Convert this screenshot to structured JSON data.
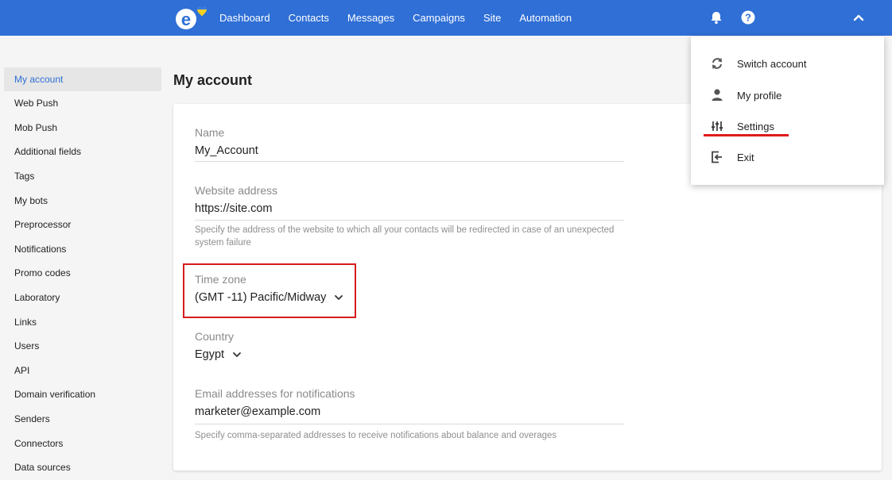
{
  "topbar": {
    "nav": [
      "Dashboard",
      "Contacts",
      "Messages",
      "Campaigns",
      "Site",
      "Automation"
    ],
    "colors": {
      "bar": "#2f6fd6",
      "logo_heart_top": "#3a7be0",
      "logo_heart_bottom": "#f5d020"
    },
    "icons": [
      "bell-icon",
      "help-icon",
      "chevron-up-icon"
    ]
  },
  "sidebar": {
    "items": [
      "My account",
      "Web Push",
      "Mob Push",
      "Additional fields",
      "Tags",
      "My bots",
      "Preprocessor",
      "Notifications",
      "Promo codes",
      "Laboratory",
      "Links",
      "Users",
      "API",
      "Domain verification",
      "Senders",
      "Connectors",
      "Data sources"
    ],
    "active": "My account"
  },
  "main": {
    "title": "My account",
    "name": {
      "label": "Name",
      "value": "My_Account"
    },
    "website": {
      "label": "Website address",
      "value": "https://site.com",
      "hint": "Specify the address of the website to which all your contacts will be redirected in case of an unexpected system failure"
    },
    "timezone": {
      "label": "Time zone",
      "value": "(GMT -11) Pacific/Midway"
    },
    "country": {
      "label": "Country",
      "value": "Egypt"
    },
    "emails": {
      "label": "Email addresses for notifications",
      "value": "marketer@example.com",
      "hint": "Specify comma-separated addresses to receive notifications about balance and overages"
    }
  },
  "menu": {
    "items": [
      {
        "label": "Switch account",
        "icon": "switch-icon"
      },
      {
        "label": "My profile",
        "icon": "user-icon"
      },
      {
        "label": "Settings",
        "icon": "sliders-icon"
      },
      {
        "label": "Exit",
        "icon": "exit-icon"
      }
    ]
  },
  "highlight_color": "#d61b1b"
}
